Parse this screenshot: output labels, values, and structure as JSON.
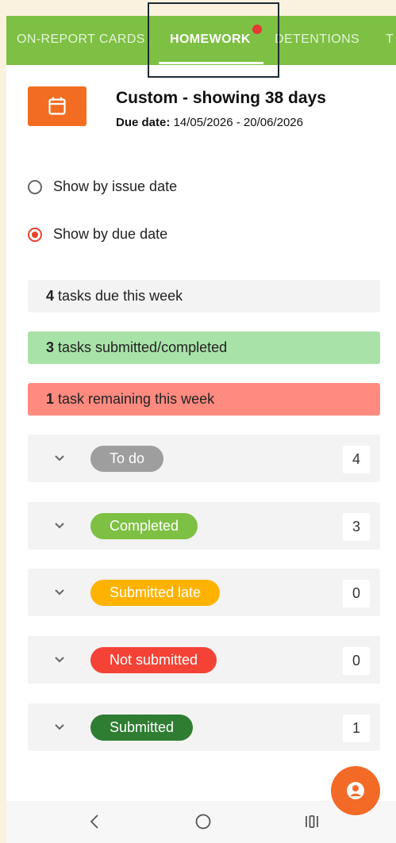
{
  "tabs": [
    {
      "label": "ON-REPORT CARDS",
      "active": false
    },
    {
      "label": "HOMEWORK",
      "active": true
    },
    {
      "label": "DETENTIONS",
      "active": false
    },
    {
      "label": "T",
      "active": false
    }
  ],
  "header": {
    "title": "Custom - showing 38 days",
    "due_label": "Due date:",
    "due_range": " 14/05/2026 - 20/06/2026"
  },
  "filter": {
    "options": [
      {
        "label": "Show by issue date",
        "selected": false
      },
      {
        "label": "Show by due date",
        "selected": true
      }
    ]
  },
  "summary": {
    "due": {
      "count": "4",
      "text": " tasks due this week"
    },
    "submitted": {
      "count": "3",
      "text": " tasks submitted/completed"
    },
    "remaining": {
      "count": "1",
      "text": " task remaining this week"
    }
  },
  "groups": [
    {
      "label": "To do",
      "count": "4",
      "color": "#9e9e9e"
    },
    {
      "label": "Completed",
      "count": "3",
      "color": "#7dc043"
    },
    {
      "label": "Submitted late",
      "count": "0",
      "color": "#ffb300"
    },
    {
      "label": "Not submitted",
      "count": "0",
      "color": "#f44336"
    },
    {
      "label": "Submitted",
      "count": "1",
      "color": "#2e7d32"
    }
  ],
  "colors": {
    "tabbar": "#7dc043",
    "accent": "#f26d21",
    "summary_neutral": "#f3f3f3",
    "summary_success": "#a9e2a9",
    "summary_danger": "#ff8a80"
  },
  "icons": {
    "calendar": "calendar-icon",
    "chevron": "chevron-down-icon",
    "fab": "user-icon",
    "nav_back": "back-icon",
    "nav_home": "home-icon",
    "nav_recents": "recents-icon"
  }
}
